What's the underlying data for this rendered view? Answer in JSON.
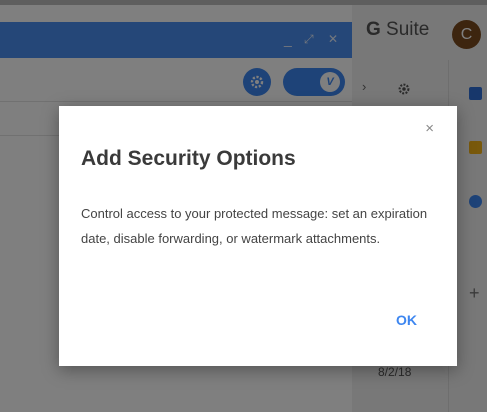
{
  "compose": {
    "minimize_icon": "_",
    "expand_icon": "⤢",
    "close_icon": "✕",
    "toggle_label": "V"
  },
  "sidebar": {
    "brand_prefix": "G",
    "brand_suffix": " Suite",
    "avatar_initial": "C",
    "chevron": "›",
    "add_icon": "+",
    "date": "8/2/18"
  },
  "modal": {
    "close": "×",
    "title": "Add Security Options",
    "body": "Control access to your protected message: set an expiration date, disable forwarding, or watermark attachments.",
    "ok_label": "OK"
  },
  "colors": {
    "accent": "#3d86f0",
    "header": "#4a8ff0"
  }
}
